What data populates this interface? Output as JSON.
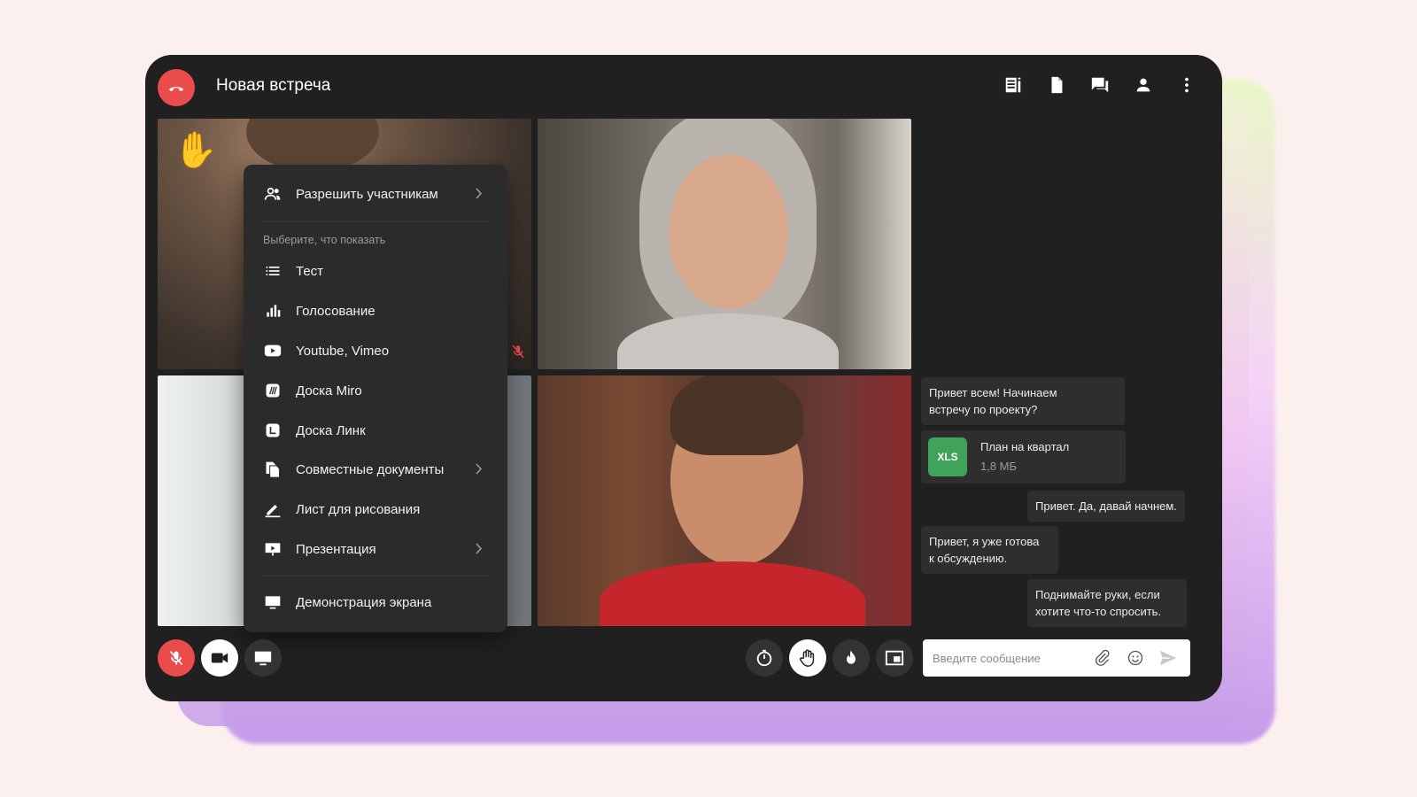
{
  "meeting": {
    "title": "Новая встреча"
  },
  "header_icons": [
    "notes-icon",
    "document-icon",
    "chat-icon",
    "participants-icon",
    "more-vertical-icon"
  ],
  "tiles": {
    "raised_hand_emoji": "✋"
  },
  "menu": {
    "allow_participants": "Разрешить участникам",
    "caption": "Выберите, что показать",
    "items": [
      {
        "label": "Тест",
        "icon": "list-icon",
        "has_submenu": false
      },
      {
        "label": "Голосование",
        "icon": "poll-icon",
        "has_submenu": false
      },
      {
        "label": "Youtube, Vimeo",
        "icon": "youtube-icon",
        "has_submenu": false
      },
      {
        "label": "Доска Miro",
        "icon": "miro-icon",
        "has_submenu": false
      },
      {
        "label": "Доска Линк",
        "icon": "link-board-icon",
        "has_submenu": false
      },
      {
        "label": "Совместные документы",
        "icon": "documents-icon",
        "has_submenu": true
      },
      {
        "label": "Лист для рисования",
        "icon": "pencil-icon",
        "has_submenu": false
      },
      {
        "label": "Презентация",
        "icon": "presentation-icon",
        "has_submenu": true
      }
    ],
    "screen_share": "Демонстрация экрана"
  },
  "chat": {
    "messages": [
      {
        "text_line1": "Привет всем! Начинаем",
        "text_line2": "встречу по проекту?",
        "side": "left"
      },
      {
        "text_line1": "Привет. Да, давай начнем.",
        "side": "right"
      },
      {
        "text_line1": "Привет, я уже готова",
        "text_line2": "к обсуждению.",
        "side": "left"
      },
      {
        "text_line1": "Поднимайте руки, если",
        "text_line2": "хотите что-то спросить.",
        "side": "right"
      }
    ],
    "file": {
      "badge": "XLS",
      "name": "План на квартал",
      "size": "1,8 МБ"
    },
    "input_placeholder": "Введите сообщение"
  },
  "colors": {
    "window_bg": "#202020",
    "end_call_red": "#ea4b4b",
    "xls_green": "#3fa35c",
    "menu_bg": "#2b2b2b"
  }
}
